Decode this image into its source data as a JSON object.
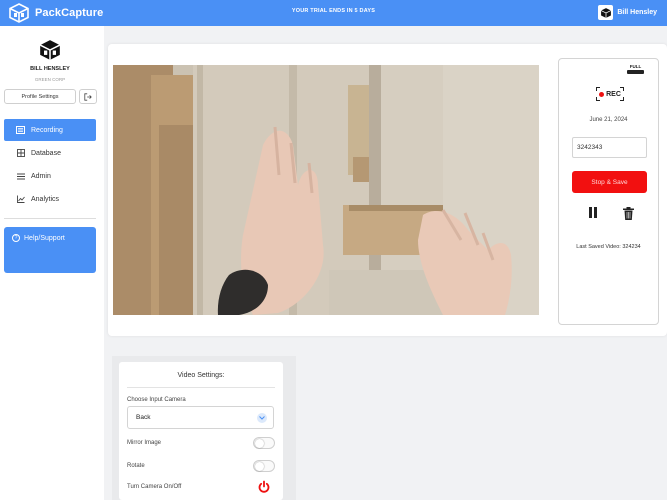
{
  "topbar": {
    "brand_name": "PackCapture",
    "trial_notice": "YOUR TRIAL ENDS IN 5 DAYS",
    "user_name": "Bill Hensley"
  },
  "sidebar": {
    "user_name": "BILL HENSLEY",
    "org_name": "GREEN CORP",
    "profile_button": "Profile Settings",
    "nav": [
      {
        "label": "Recording",
        "icon": "video-list-icon",
        "active": true
      },
      {
        "label": "Database",
        "icon": "grid-icon",
        "active": false
      },
      {
        "label": "Admin",
        "icon": "menu-icon",
        "active": false
      },
      {
        "label": "Analytics",
        "icon": "line-chart-icon",
        "active": false
      }
    ],
    "help_label": "Help/Support"
  },
  "recorder": {
    "full_badge": "FULL",
    "rec_label": "REC",
    "date": "June 21, 2024",
    "order_value": "3242343",
    "stop_save_label": "Stop & Save",
    "last_saved": "Last Saved Video: 324234"
  },
  "settings": {
    "title": "Video Settings:",
    "choose_camera_label": "Choose Input Camera",
    "camera_value": "Back",
    "mirror_label": "Mirror Image",
    "mirror_on": false,
    "rotate_label": "Rotate",
    "rotate_on": false,
    "camera_power_label": "Turn Camera On/Off"
  },
  "colors": {
    "accent": "#4a90f5",
    "record_red": "#f21010"
  }
}
